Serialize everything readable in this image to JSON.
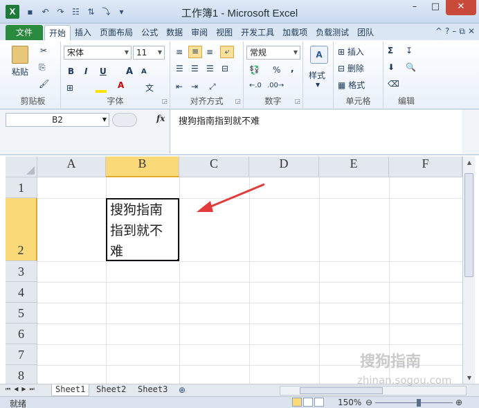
{
  "window": {
    "title": "工作簿1 - Microsoft Excel",
    "app_icon": "X",
    "controls": [
      "–",
      "□",
      "✕"
    ]
  },
  "qat": {
    "icons": [
      "save-icon",
      "undo-icon",
      "redo-icon",
      "customize-icon"
    ],
    "glyphs": [
      "▪",
      "↶",
      "↷",
      "☷",
      "⇅",
      "⤵",
      "▾"
    ]
  },
  "ribbon_tabs": {
    "file": "文件",
    "items": [
      "开始",
      "插入",
      "页面布局",
      "公式",
      "数据",
      "审阅",
      "视图",
      "开发工具",
      "加载项",
      "负载测试",
      "团队"
    ],
    "active_index": 0,
    "right_icons": [
      "^",
      "?",
      "–",
      "⧉",
      "✕"
    ]
  },
  "ribbon": {
    "clipboard": {
      "paste": "粘贴",
      "label": "剪贴板"
    },
    "font": {
      "name": "宋体",
      "size": "11",
      "label": "字体",
      "bold": "B",
      "italic": "I",
      "underline": "U",
      "grow": "A",
      "shrink": "A"
    },
    "alignment": {
      "label": "对齐方式"
    },
    "number": {
      "format": "常规",
      "percent": "%",
      "comma": ",",
      "label": "数字"
    },
    "styles": {
      "button": "样式"
    },
    "cells": {
      "insert": "插入",
      "delete": "删除",
      "format": "格式",
      "label": "单元格"
    },
    "editing": {
      "sum": "Σ",
      "label": "编辑"
    }
  },
  "formula_bar": {
    "name_box": "B2",
    "fx": "fx",
    "content": "搜狗指南指到就不难"
  },
  "sheet": {
    "columns": [
      "A",
      "B",
      "C",
      "D",
      "E",
      "F"
    ],
    "selected_column": "B",
    "rows": [
      "1",
      "2",
      "3",
      "4",
      "5",
      "6",
      "7",
      "8"
    ],
    "selected_row": "2",
    "active_cell": {
      "address": "B2",
      "lines": [
        "搜狗指南",
        "指到就不",
        "难"
      ]
    }
  },
  "sheet_tabs": {
    "tabs": [
      "Sheet1",
      "Sheet2",
      "Sheet3"
    ],
    "active_index": 0
  },
  "status_bar": {
    "ready": "就绪",
    "zoom": "150%"
  },
  "watermark": {
    "text": "搜狗指南",
    "url": "zhinan.sogou.com"
  },
  "colors": {
    "file_tab": "#2a8a3e",
    "selection_header": "#f9d978",
    "annotation_arrow": "#e23b3b"
  }
}
